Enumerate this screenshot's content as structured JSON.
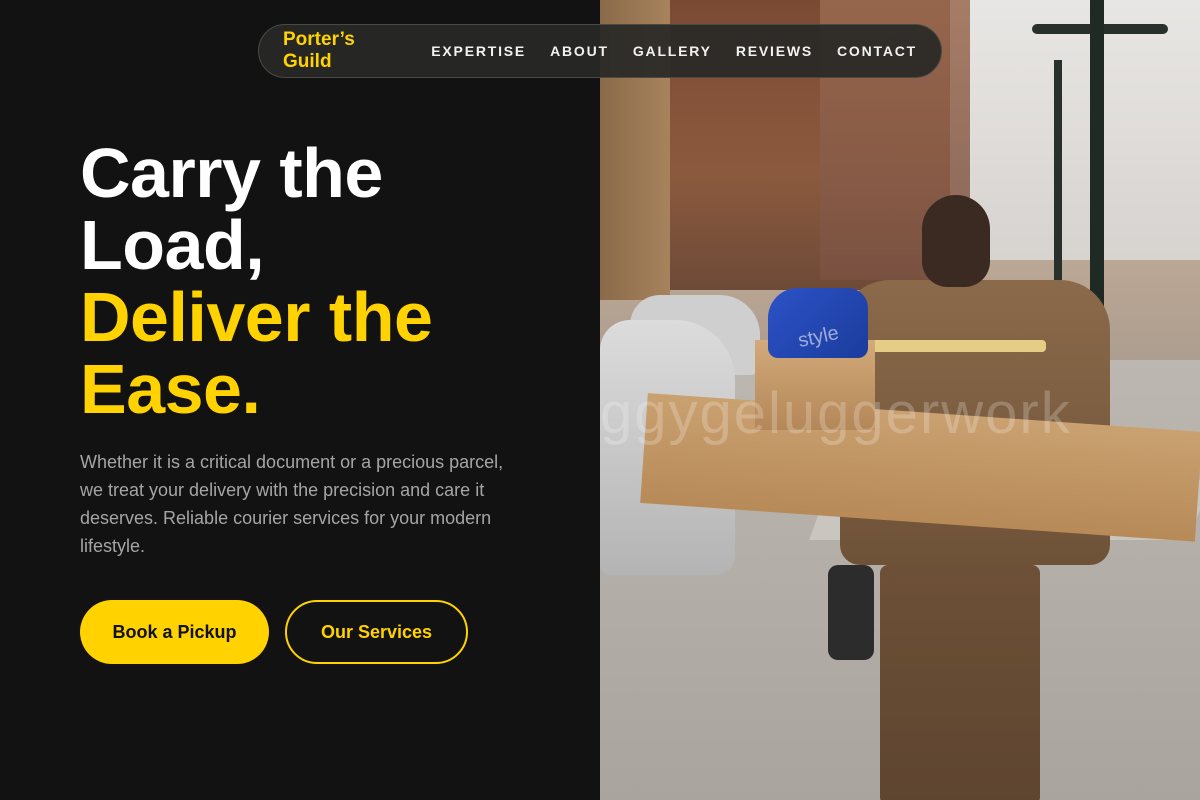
{
  "nav": {
    "brand": "Porter’s Guild",
    "links": [
      "EXPERTISE",
      "ABOUT",
      "GALLERY",
      "REVIEWS",
      "CONTACT"
    ]
  },
  "hero": {
    "line1": "Carry the",
    "line2": "Load,",
    "line3": "Deliver the",
    "line4": "Ease.",
    "description": "Whether it is a critical document or a precious parcel, we treat your delivery with the precision and care it deserves. Reliable courier services for your modern lifestyle.",
    "primary_button": "Book a Pickup",
    "secondary_button": "Our Services"
  },
  "photo": {
    "watermark": "ggygeluggerwork",
    "bag_text": "style"
  },
  "colors": {
    "accent": "#ffd200",
    "background": "#121212",
    "text_muted": "#a5a5a5"
  }
}
